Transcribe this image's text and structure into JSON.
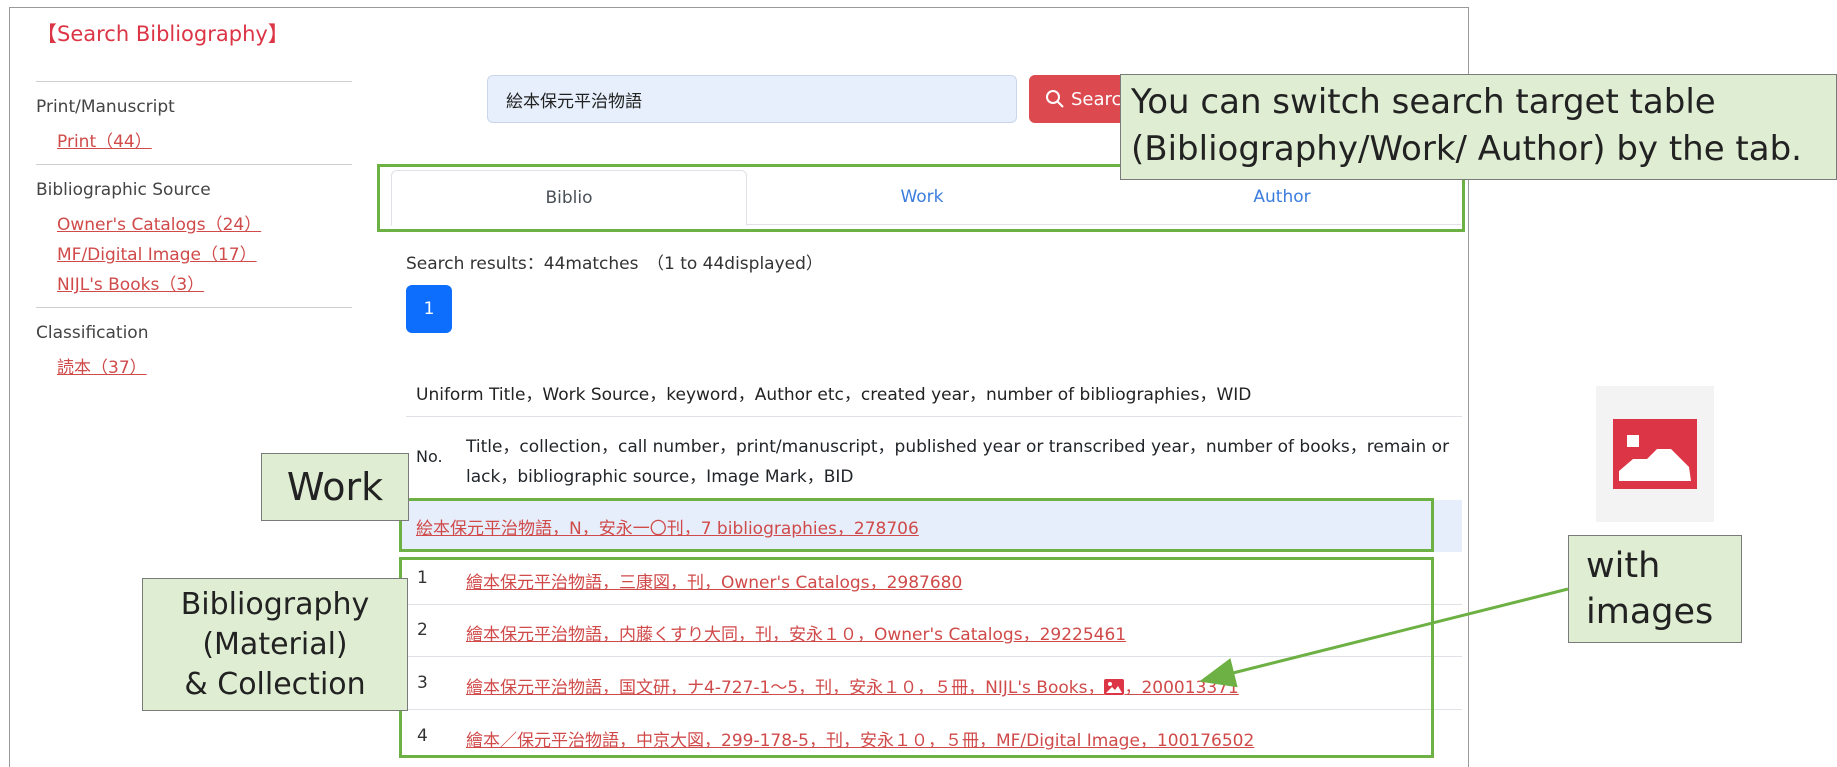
{
  "sidebar": {
    "title": "【Search Bibliography】",
    "groups": [
      {
        "heading": "Print/Manuscript",
        "items": [
          "Print（44）"
        ]
      },
      {
        "heading": "Bibliographic Source",
        "items": [
          "Owner's Catalogs（24）",
          "MF/Digital Image（17）",
          "NIJL's Books（3）"
        ]
      },
      {
        "heading": "Classification",
        "items": [
          "読本（37）"
        ]
      }
    ]
  },
  "search": {
    "value": "絵本保元平治物語",
    "button_label": "Search"
  },
  "tabs": [
    {
      "label": "Biblio",
      "active": true
    },
    {
      "label": "Work",
      "active": false
    },
    {
      "label": "Author",
      "active": false
    }
  ],
  "results": {
    "summary": "Search results：44matches　（1 to 44displayed）",
    "page": "1",
    "work_header": "Uniform Title，Work Source，keyword，Author etc，created year，number of bibliographies，WID",
    "biblio_no_header": "No.",
    "biblio_header": "Title，collection，call number，print/manuscript，published year or transcribed year，number of books，remain or lack，bibliographic source，Image Mark，BID",
    "work_row": "絵本保元平治物語，N，安永一〇刊，7 bibliographies，278706",
    "rows": [
      {
        "no": "1",
        "text": "繪本保元平治物語，三康図，刊，Owner's Catalogs，2987680"
      },
      {
        "no": "2",
        "text": "繪本保元平治物語，内藤くすり大同，刊，安永１０，Owner's Catalogs，29225461"
      },
      {
        "no": "3",
        "text_before": "繪本保元平治物語，国文研，ナ4-727-1～5，刊，安永１０，５冊，NIJL's Books，",
        "text_after": "，200013371",
        "has_image": true
      },
      {
        "no": "4",
        "text": "繪本／保元平治物語，中京大図，299-178-5，刊，安永１０，５冊，MF/Digital Image，100176502"
      }
    ]
  },
  "callouts": {
    "tab_note_line1": "You can switch search target table",
    "tab_note_line2": "(Bibliography/Work/ Author)  by the tab.",
    "work": "Work",
    "bibliography_line1": "Bibliography",
    "bibliography_line2": "(Material)",
    "bibliography_line3": "& Collection",
    "images_line1": "with",
    "images_line2": "images"
  },
  "colors": {
    "accent_red": "#dc3545",
    "link_red": "#d04a4a",
    "tab_blue": "#3b7ddd",
    "page_blue": "#0d6efd",
    "annotation_green": "#6db044",
    "callout_fill": "#dfeed3"
  },
  "icons": {
    "search_button_icon": "search-icon",
    "image_mark": "image-icon"
  }
}
